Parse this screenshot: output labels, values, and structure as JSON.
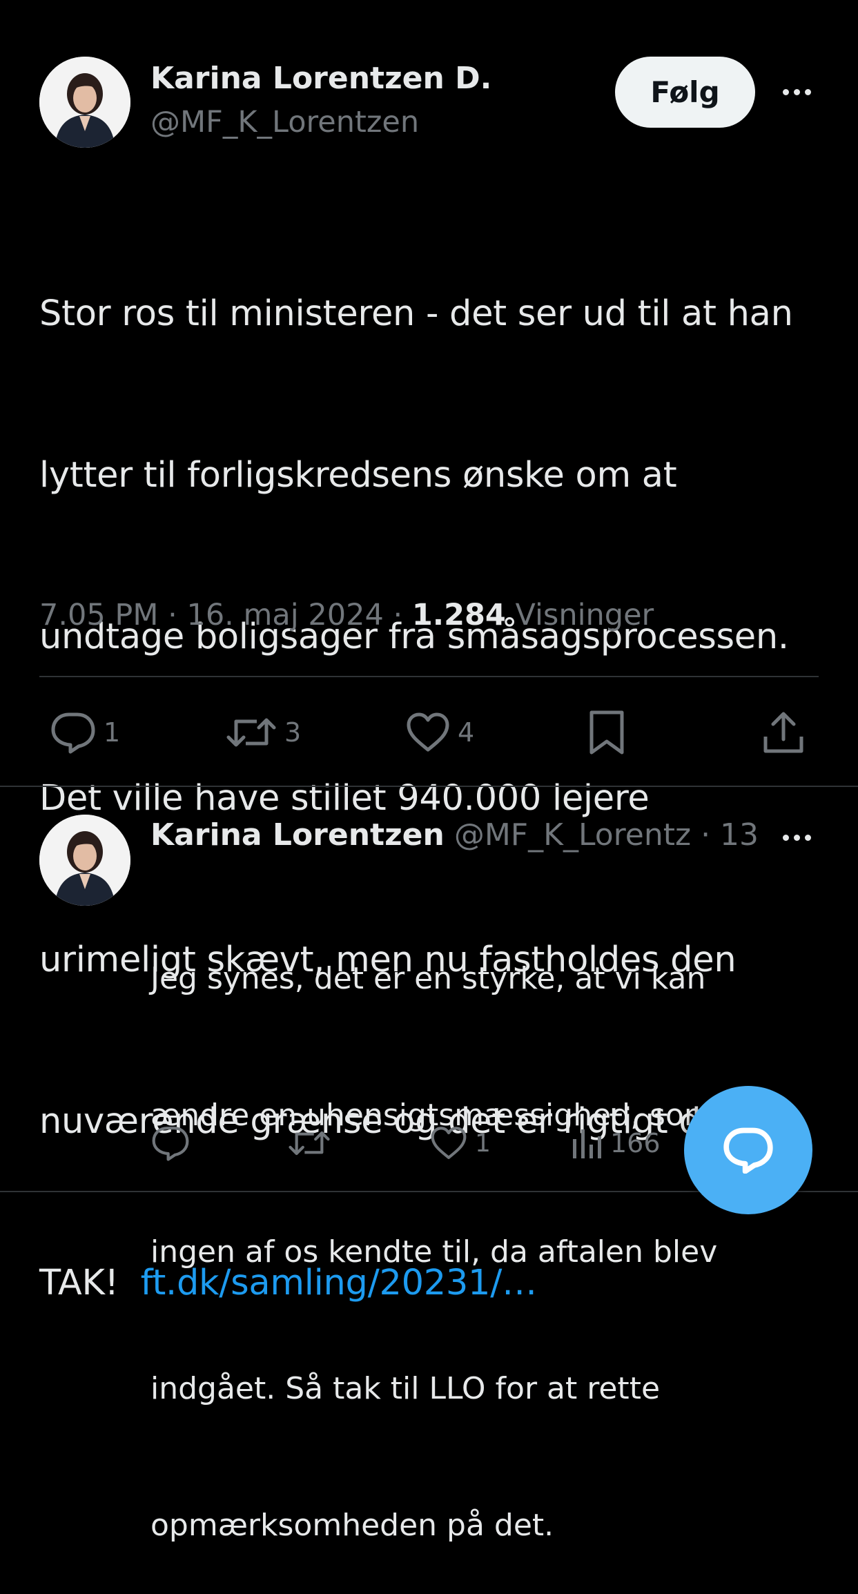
{
  "main_tweet": {
    "author_name": "Karina Lorentzen D.",
    "handle": "@MF_K_Lorentzen",
    "follow_label": "Følg",
    "text_lines": [
      "Stor ros til ministeren - det ser ud til at han",
      "lytter til forligskredsens ønske om at",
      "undtage boligsager fra småsagsprocessen.",
      "Det ville have stillet 940.000 lejere",
      "urimeligt skævt, men nu fastholdes den",
      "nuværende grænse og det er rigtigt dejligt."
    ],
    "last_line_prefix": "TAK!  ",
    "link_text": "ft.dk/samling/20231/…",
    "time": "7.05 PM",
    "date": "16. maj 2024",
    "views_count": "1.284",
    "views_label": "Visninger",
    "actions": {
      "replies": "1",
      "reposts": "3",
      "likes": "4"
    }
  },
  "reply_tweet": {
    "author_name": "Karina Lorentzen",
    "handle": "@MF_K_Lorentz",
    "time_ago": "· 13 t",
    "text_lines": [
      "Jeg synes, det er en styrke, at vi kan",
      "ændre en uhensigtsmæssighed, som",
      "ingen af os kendte til, da aftalen blev",
      "indgået. Så tak til LLO for at rette",
      "opmærksomheden på det."
    ],
    "actions": {
      "replies": "",
      "reposts": "",
      "likes": "1",
      "views": "166"
    }
  },
  "colors": {
    "background": "#000000",
    "text": "#e7e9ea",
    "secondary": "#71767b",
    "link": "#1d9bf0",
    "divider": "#2f3336",
    "fab": "#4bb0f5"
  }
}
